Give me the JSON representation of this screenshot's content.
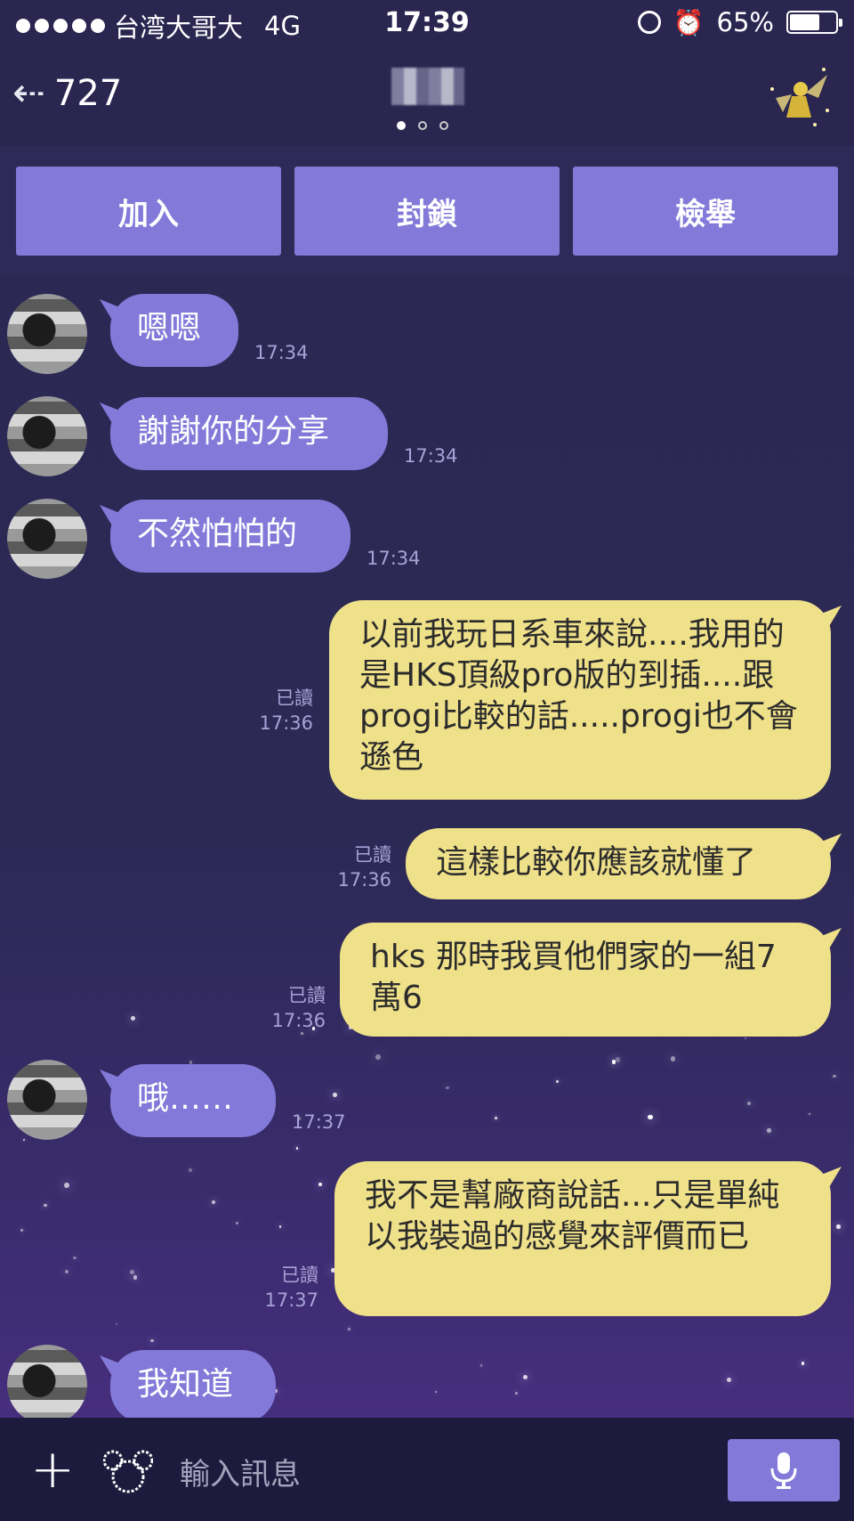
{
  "status_bar": {
    "carrier": "台湾大哥大",
    "network": "4G",
    "time": "17:39",
    "battery": "65%",
    "battery_level": 0.65
  },
  "nav": {
    "back_count": "727",
    "pager_pages": 3,
    "pager_active": 0
  },
  "actions": {
    "add": "加入",
    "block": "封鎖",
    "report": "檢舉"
  },
  "messages": [
    {
      "side": "in",
      "text": "嗯嗯",
      "time": "17:34"
    },
    {
      "side": "in",
      "text": "謝謝你的分享",
      "time": "17:34"
    },
    {
      "side": "in",
      "text": "不然怕怕的",
      "time": "17:34"
    },
    {
      "side": "out",
      "text": "以前我玩日系車來說....我用的是HKS頂級pro版的到插....跟progi比較的話.....progi也不會遜色",
      "read": "已讀",
      "time": "17:36"
    },
    {
      "side": "out",
      "text": "這樣比較你應該就懂了",
      "read": "已讀",
      "time": "17:36"
    },
    {
      "side": "out",
      "text": "hks 那時我買他們家的一組7萬6",
      "read": "已讀",
      "time": "17:36"
    },
    {
      "side": "in",
      "text": "哦……",
      "time": "17:37"
    },
    {
      "side": "out",
      "text": "我不是幫廠商說話...只是單純以我裝過的感覺來評價而已",
      "read": "已讀",
      "time": "17:37"
    },
    {
      "side": "in",
      "text": "我知道",
      "time": ""
    }
  ],
  "input": {
    "placeholder": "輸入訊息"
  },
  "colors": {
    "background": "#2c2955",
    "incoming_bubble": "#8379d9",
    "outgoing_bubble": "#efe08a",
    "action_button": "#8379d9",
    "meta_text": "#a8a2d6"
  }
}
